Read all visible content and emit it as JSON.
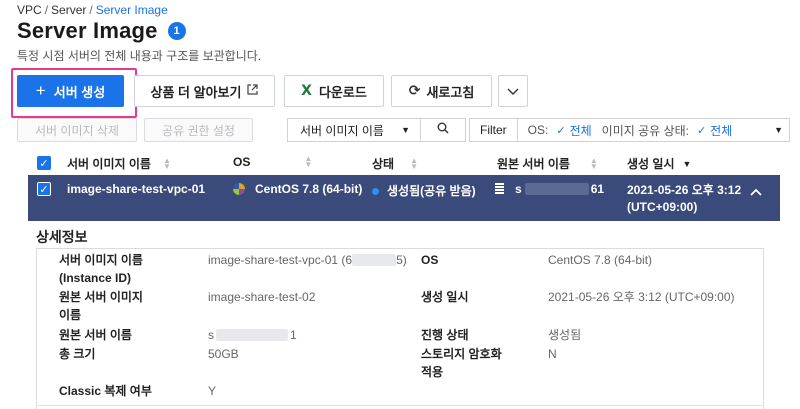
{
  "breadcrumb": {
    "items": [
      "VPC",
      "Server"
    ],
    "current": "Server Image",
    "separator": "/"
  },
  "page": {
    "title": "Server Image",
    "help_badge": "1",
    "subtitle": "특정 시점 서버의 전체 내용과 구조를 보관합니다."
  },
  "toolbar": {
    "create_label": "서버 생성",
    "create_icon": "plus-icon",
    "learn_label": "상품 더 알아보기",
    "learn_icon": "external-link-icon",
    "download_label": "다운로드",
    "download_icon": "excel-icon",
    "refresh_label": "새로고침",
    "refresh_icon": "refresh-icon",
    "more_icon": "chevron-down-icon"
  },
  "actions": {
    "delete_label": "서버 이미지 삭제",
    "permission_label": "공유 권한 설정"
  },
  "search": {
    "field_selected": "서버 이미지 이름",
    "search_icon": "search-icon"
  },
  "filter": {
    "label": "Filter",
    "os_label": "OS:",
    "os_value": "전체",
    "share_label": "이미지 공유 상태:",
    "share_value": "전체"
  },
  "table": {
    "columns": [
      "서버 이미지 이름",
      "OS",
      "상태",
      "원본 서버 이름",
      "생성 일시"
    ],
    "rows": [
      {
        "name": "image-share-test-vpc-01",
        "os": "CentOS 7.8 (64-bit)",
        "status": "생성됨(공유 받음)",
        "origin_server_prefix": "s",
        "origin_server_suffix": "61",
        "created_line1": "2021-05-26 오후 3:12",
        "created_line2": "(UTC+09:00)",
        "selected": true
      }
    ]
  },
  "details": {
    "title": "상세정보",
    "fields": {
      "image_name_label_1": "서버 이미지 이름",
      "image_name_label_2": "(Instance ID)",
      "image_name_value_prefix": "image-share-test-vpc-01 (6",
      "image_name_value_suffix": "5)",
      "os_label": "OS",
      "os_value": "CentOS 7.8 (64-bit)",
      "origin_image_label_1": "원본 서버 이미지",
      "origin_image_label_2": "이름",
      "origin_image_value": "image-share-test-02",
      "created_label": "생성 일시",
      "created_value": "2021-05-26 오후 3:12 (UTC+09:00)",
      "origin_server_label": "원본 서버 이름",
      "origin_server_value_prefix": "s",
      "origin_server_value_suffix": "1",
      "progress_label": "진행 상태",
      "progress_value": "생성됨",
      "size_label": "총 크기",
      "size_value": "50GB",
      "encryption_label_1": "스토리지 암호화",
      "encryption_label_2": "적용",
      "encryption_value": "N",
      "classic_label": "Classic 복제 여부",
      "classic_value": "Y"
    }
  },
  "colors": {
    "accent": "#1a73e8",
    "selected_row": "#3a4a7a",
    "highlight": "#e8398e",
    "excel": "#1e7a3e"
  }
}
